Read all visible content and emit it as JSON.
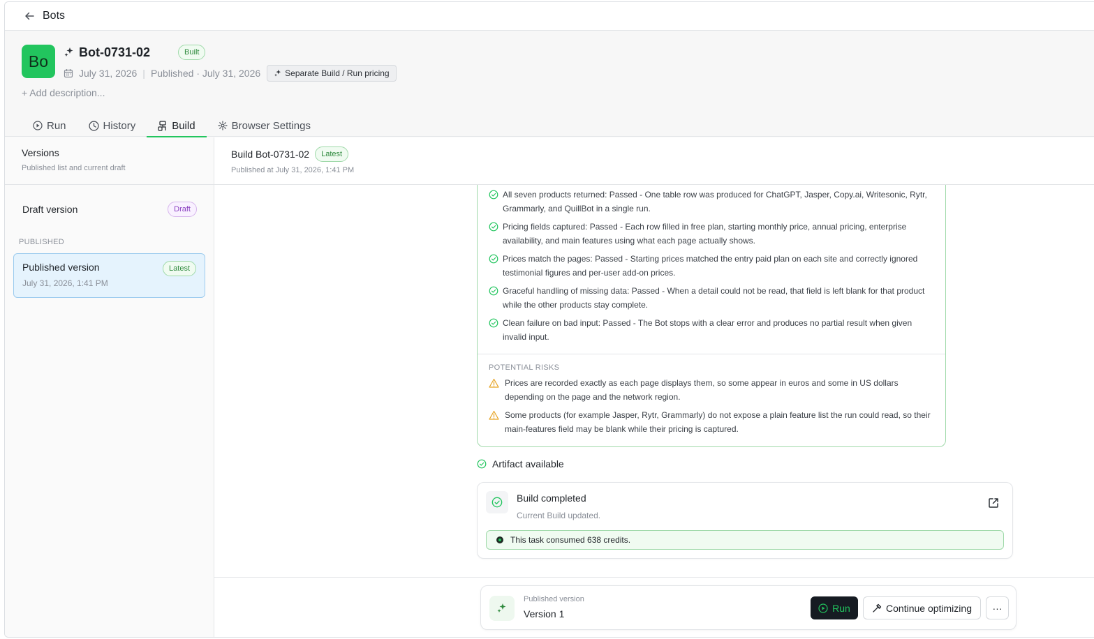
{
  "topbar": {
    "breadcrumb": "Bots"
  },
  "bot": {
    "avatar_text": "Bo",
    "name": "Bot-0731-02",
    "status": "Built",
    "created": "July 31, 2026",
    "published": "Published · July 31, 2026",
    "pricing_label": "Separate Build / Run pricing",
    "add_description": "+ Add description..."
  },
  "tabs": [
    {
      "label": "Run",
      "icon": "play-icon"
    },
    {
      "label": "History",
      "icon": "clock-icon"
    },
    {
      "label": "Build",
      "icon": "build-icon",
      "active": true
    },
    {
      "label": "Browser Settings",
      "icon": "gear-icon"
    }
  ],
  "versions": {
    "title": "Versions",
    "subtitle": "Published list and current draft",
    "draft_label": "Draft version",
    "draft_badge": "Draft",
    "published_section": "PUBLISHED",
    "published_label": "Published version",
    "published_badge": "Latest",
    "published_date": "July 31, 2026, 1:41 PM"
  },
  "build": {
    "title": "Build Bot-0731-02",
    "badge": "Latest",
    "published_at": "Published at July 31, 2026, 1:41 PM",
    "checks": [
      "All seven products returned: Passed - One table row was produced for ChatGPT, Jasper, Copy.ai, Writesonic, Rytr, Grammarly, and QuillBot in a single run.",
      "Pricing fields captured: Passed - Each row filled in free plan, starting monthly price, annual pricing, enterprise availability, and main features using what each page actually shows.",
      "Prices match the pages: Passed - Starting prices matched the entry paid plan on each site and correctly ignored testimonial figures and per-user add-on prices.",
      "Graceful handling of missing data: Passed - When a detail could not be read, that field is left blank for that product while the other products stay complete.",
      "Clean failure on bad input: Passed - The Bot stops with a clear error and produces no partial result when given invalid input."
    ],
    "risks_heading": "POTENTIAL RISKS",
    "risks": [
      "Prices are recorded exactly as each page displays them, so some appear in euros and some in US dollars depending on the page and the network region.",
      "Some products (for example Jasper, Rytr, Grammarly) do not expose a plain feature list the run could read, so their main-features field may be blank while their pricing is captured."
    ],
    "artifact_label": "Artifact available",
    "completed_title": "Build completed",
    "completed_sub": "Current Build updated.",
    "credits_text": "This task consumed 638 credits."
  },
  "bottom": {
    "sub_label": "Published version",
    "version": "Version 1",
    "run_label": "Run",
    "continue_label": "Continue optimizing",
    "more_label": "···"
  },
  "colors": {
    "accent": "#22c55e",
    "dark": "#161b22",
    "selected_bg": "#e5f3fd"
  }
}
